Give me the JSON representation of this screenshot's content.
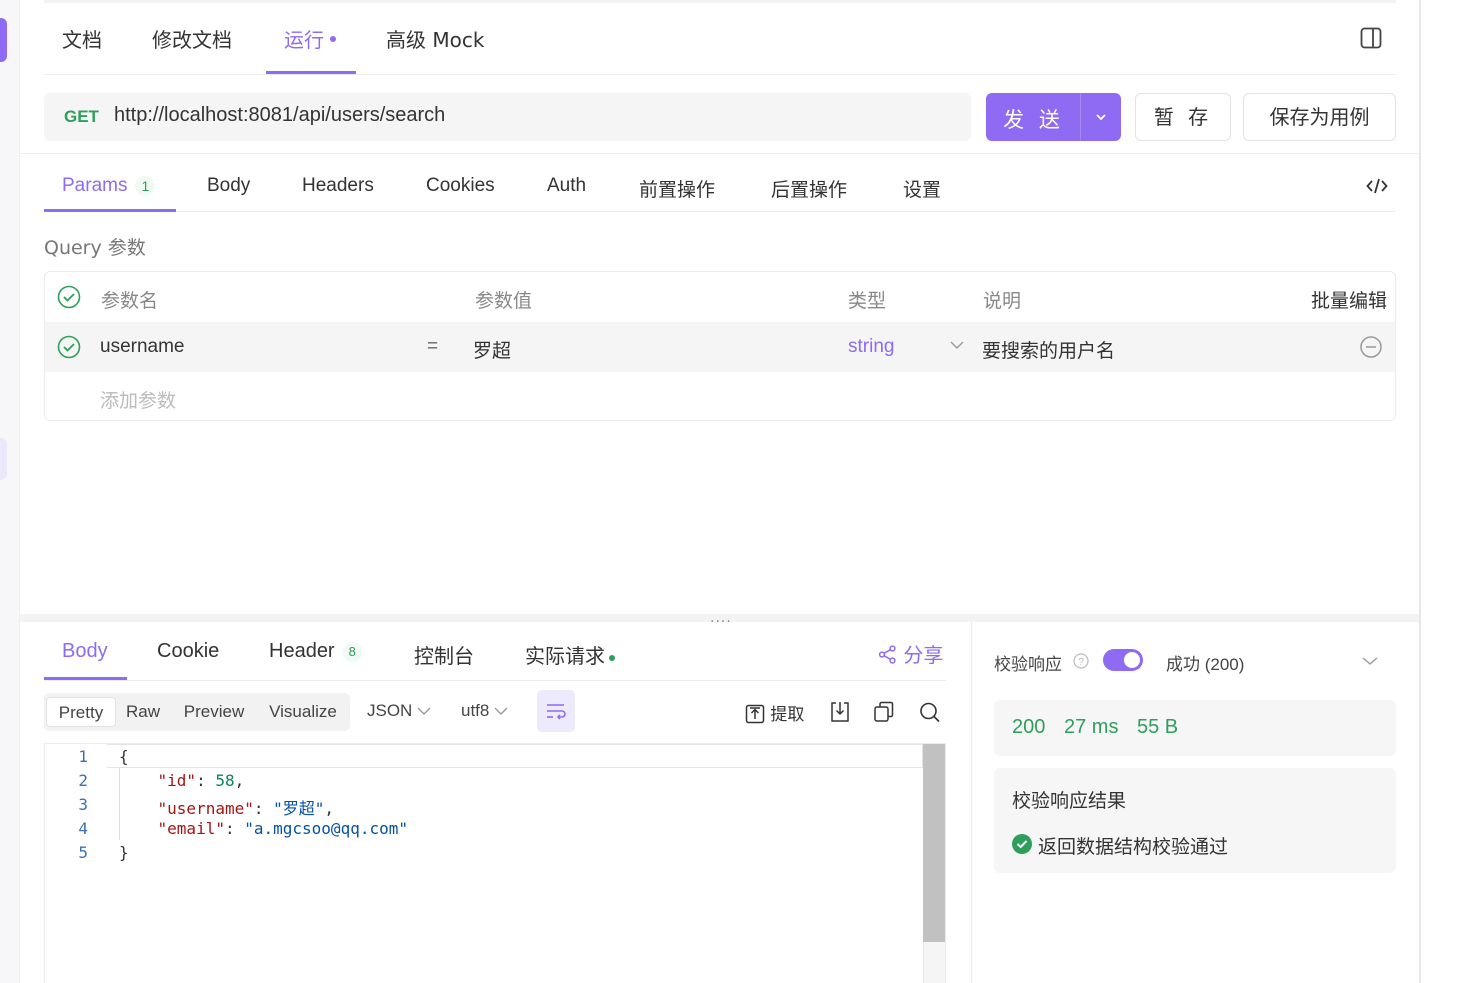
{
  "top_tabs": [
    {
      "label": "文档"
    },
    {
      "label": "修改文档"
    },
    {
      "label": "运行"
    },
    {
      "label": "高级 Mock"
    }
  ],
  "request": {
    "method": "GET",
    "url": "http://localhost:8081/api/users/search",
    "send_label": "发 送",
    "save_draft_label": "暂 存",
    "save_case_label": "保存为用例"
  },
  "request_tabs": [
    {
      "label": "Params",
      "badge": "1"
    },
    {
      "label": "Body"
    },
    {
      "label": "Headers"
    },
    {
      "label": "Cookies"
    },
    {
      "label": "Auth"
    },
    {
      "label": "前置操作"
    },
    {
      "label": "后置操作"
    },
    {
      "label": "设置"
    }
  ],
  "query": {
    "title": "Query 参数",
    "headers": {
      "name": "参数名",
      "value": "参数值",
      "type": "类型",
      "desc": "说明",
      "bulk_edit": "批量编辑"
    },
    "rows": [
      {
        "name": "username",
        "equals": "=",
        "value": "罗超",
        "type": "string",
        "desc": "要搜索的用户名"
      }
    ],
    "add_placeholder": "添加参数"
  },
  "splitter_handle": "....",
  "response_tabs": [
    {
      "label": "Body"
    },
    {
      "label": "Cookie"
    },
    {
      "label": "Header",
      "badge": "8"
    },
    {
      "label": "控制台"
    },
    {
      "label": "实际请求"
    }
  ],
  "share_label": "分享",
  "view_modes": [
    "Pretty",
    "Raw",
    "Preview",
    "Visualize"
  ],
  "format": "JSON",
  "encoding": "utf8",
  "extract_label": "提取",
  "code": {
    "line_numbers": [
      "1",
      "2",
      "3",
      "4",
      "5"
    ],
    "open": "{",
    "close": "}",
    "fields": [
      {
        "key": "\"id\"",
        "value": "58",
        "value_kind": "number",
        "comma": ","
      },
      {
        "key": "\"username\"",
        "value": "\"罗超\"",
        "value_kind": "string",
        "comma": ","
      },
      {
        "key": "\"email\"",
        "value": "\"a.mgcsoo@qq.com\"",
        "value_kind": "string",
        "comma": ""
      }
    ]
  },
  "validation": {
    "label": "校验响应",
    "enabled": true,
    "status_option": "成功 (200)",
    "status_code": "200",
    "time": "27 ms",
    "size": "55 B",
    "result_title": "校验响应结果",
    "result_message": "返回数据结构校验通过"
  },
  "colors": {
    "accent": "#8e6bf2",
    "success": "#2e9e5b"
  }
}
